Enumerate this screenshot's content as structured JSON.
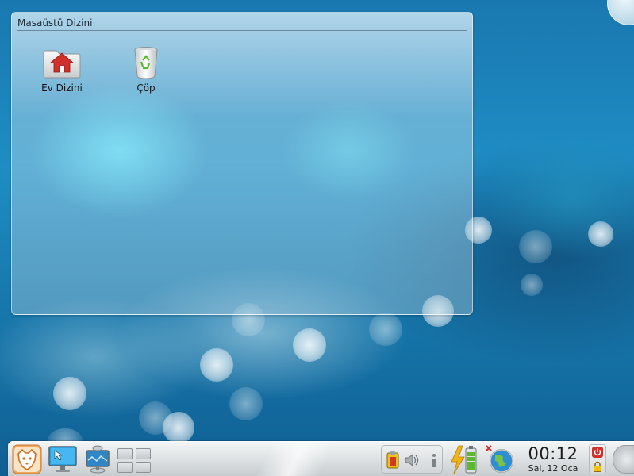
{
  "folderview": {
    "title": "Masaüstü Dizini",
    "icons": [
      {
        "label": "Ev Dizini",
        "icon": "home-folder-icon"
      },
      {
        "label": "Çöp",
        "icon": "trash-icon"
      }
    ]
  },
  "panel": {
    "launcher_icon": "kickoff-menu-icon",
    "show_desktop_icon": "show-desktop-icon",
    "network_icon": "network-icon",
    "pager_desktops": 4,
    "tray_icons": [
      "klipper-icon",
      "volume-icon",
      "notifications-icon"
    ],
    "power_icon": "battery-charging-icon",
    "update_icon": "update-globe-icon",
    "clock": {
      "time": "00:12",
      "date": "Sal, 12 Oca"
    },
    "shutdown_icon": "power-icon",
    "lock_icon": "lock-icon",
    "toolbox_icon": "panel-toolbox-icon"
  },
  "colors": {
    "wallpaper": "#1e8dc4",
    "shutdown_red": "#d0302c",
    "battery_green": "#5cb82c",
    "lightning_yellow": "#f3b316"
  }
}
